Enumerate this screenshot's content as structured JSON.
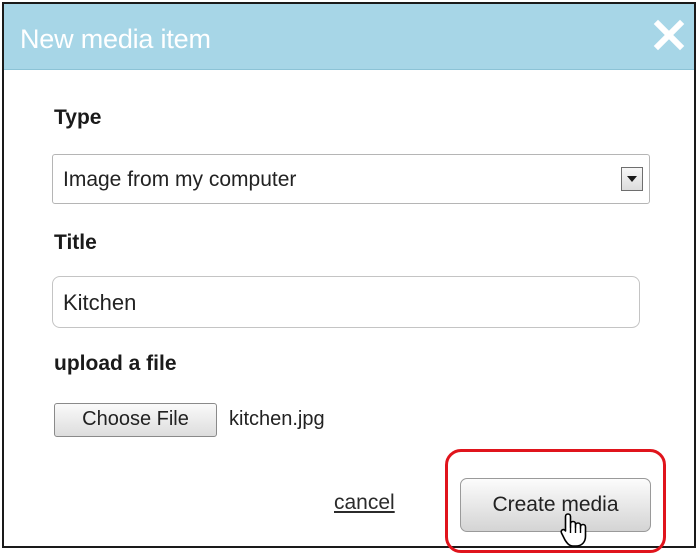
{
  "dialog": {
    "title": "New media item",
    "header_color": "#a7d6e7",
    "close_icon": "close-icon"
  },
  "form": {
    "type_label": "Type",
    "type_value": "Image from my computer",
    "title_label": "Title",
    "title_value": "Kitchen",
    "upload_label": "upload a file",
    "choose_file_label": "Choose File",
    "file_name": "kitchen.jpg"
  },
  "actions": {
    "cancel_label": "cancel",
    "create_label": "Create media",
    "highlight_color": "#e0141c"
  },
  "cursor": "hand-pointer-icon"
}
